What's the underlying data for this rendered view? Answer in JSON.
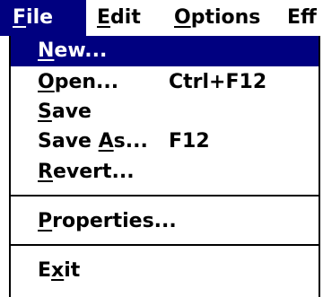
{
  "menubar": {
    "items": [
      {
        "pre": "",
        "mnemonic": "F",
        "post": "ile"
      },
      {
        "pre": "",
        "mnemonic": "E",
        "post": "dit"
      },
      {
        "pre": "",
        "mnemonic": "O",
        "post": "ptions"
      },
      {
        "text": "Eff"
      }
    ]
  },
  "file_menu": {
    "items": [
      {
        "pre": "",
        "mnemonic": "N",
        "post": "ew...",
        "shortcut": ""
      },
      {
        "pre": "",
        "mnemonic": "O",
        "post": "pen...",
        "shortcut": "Ctrl+F12"
      },
      {
        "pre": "",
        "mnemonic": "S",
        "post": "ave",
        "shortcut": ""
      },
      {
        "pre": "Save ",
        "mnemonic": "A",
        "post": "s...",
        "shortcut": "F12"
      },
      {
        "pre": "",
        "mnemonic": "R",
        "post": "evert...",
        "shortcut": ""
      },
      {
        "pre": "",
        "mnemonic": "P",
        "post": "roperties...",
        "shortcut": ""
      },
      {
        "pre": "E",
        "mnemonic": "x",
        "post": "it",
        "shortcut": ""
      }
    ]
  },
  "colors": {
    "highlight": "#000080",
    "highlight_text": "#ffffff",
    "text": "#000000",
    "background": "#ffffff"
  }
}
